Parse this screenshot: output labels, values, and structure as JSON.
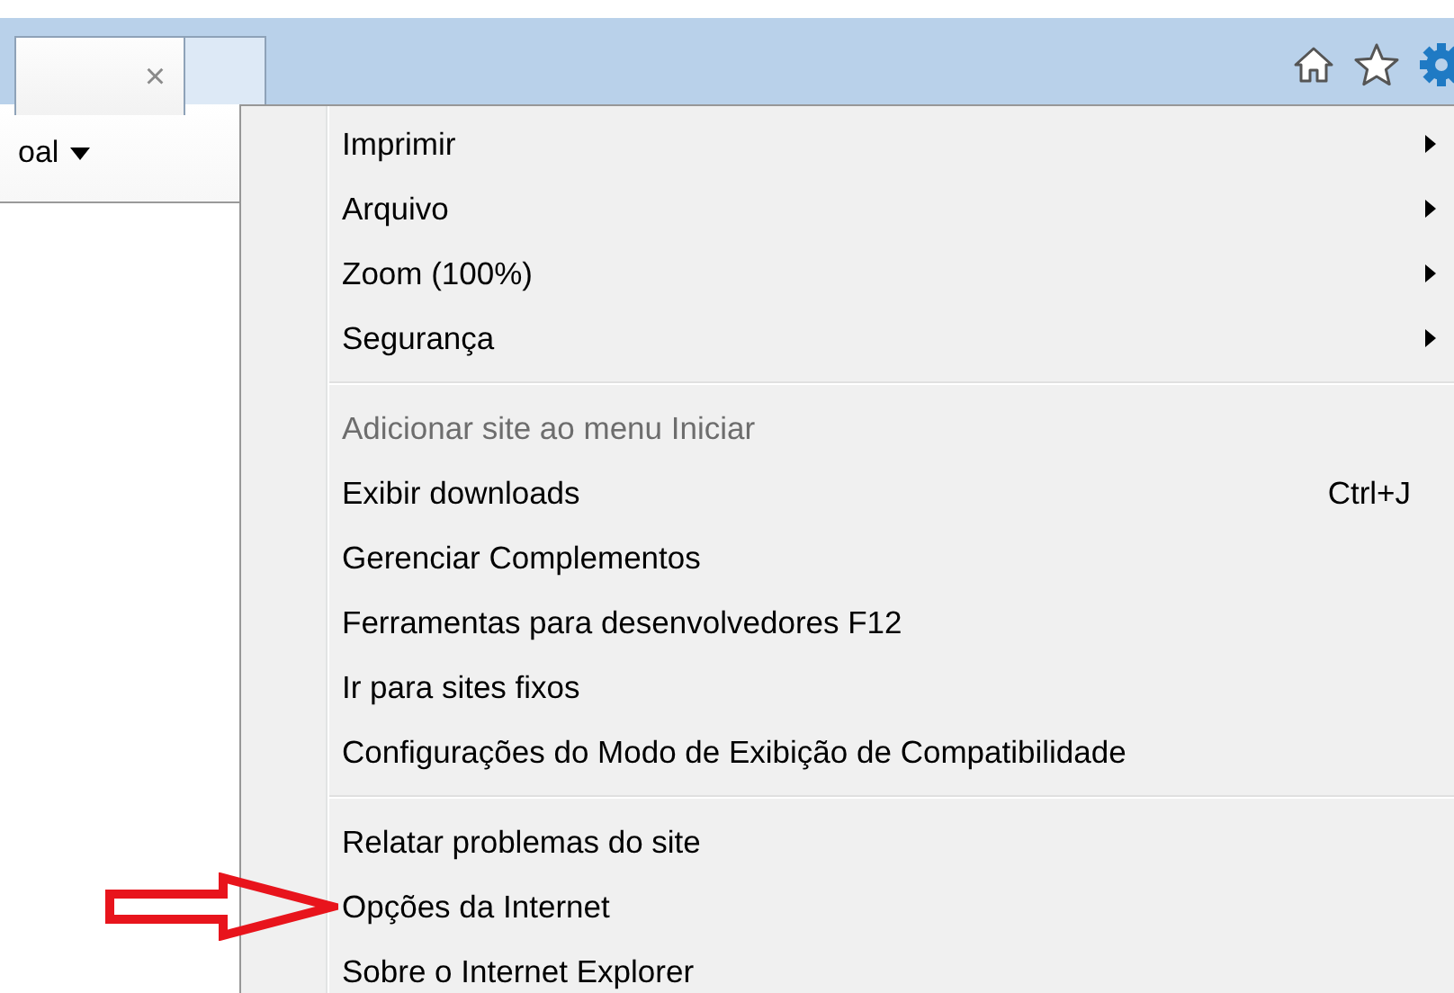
{
  "tab": {
    "close": "×"
  },
  "toolbar": {
    "label": "oal"
  },
  "menu": {
    "groups": [
      [
        {
          "label": "Imprimir",
          "disabled": false,
          "submenu": true,
          "annotated": false
        },
        {
          "label": "Arquivo",
          "disabled": false,
          "submenu": true,
          "annotated": false
        },
        {
          "label": "Zoom (100%)",
          "disabled": false,
          "submenu": true,
          "annotated": false
        },
        {
          "label": "Segurança",
          "disabled": false,
          "submenu": true,
          "annotated": false
        }
      ],
      [
        {
          "label": "Adicionar site ao menu Iniciar",
          "disabled": true,
          "submenu": false,
          "annotated": false
        },
        {
          "label": "Exibir downloads",
          "disabled": false,
          "submenu": false,
          "annotated": false,
          "shortcut": "Ctrl+J"
        },
        {
          "label": "Gerenciar Complementos",
          "disabled": false,
          "submenu": false,
          "annotated": false
        },
        {
          "label": "Ferramentas para desenvolvedores F12",
          "disabled": false,
          "submenu": false,
          "annotated": false
        },
        {
          "label": "Ir para sites fixos",
          "disabled": false,
          "submenu": false,
          "annotated": false
        },
        {
          "label": "Configurações do Modo de Exibição de Compatibilidade",
          "disabled": false,
          "submenu": false,
          "annotated": false
        }
      ],
      [
        {
          "label": "Relatar problemas do site",
          "disabled": false,
          "submenu": false,
          "annotated": false
        },
        {
          "label": "Opções da Internet",
          "disabled": false,
          "submenu": false,
          "annotated": true
        },
        {
          "label": "Sobre o Internet Explorer",
          "disabled": false,
          "submenu": false,
          "annotated": false
        }
      ]
    ]
  }
}
